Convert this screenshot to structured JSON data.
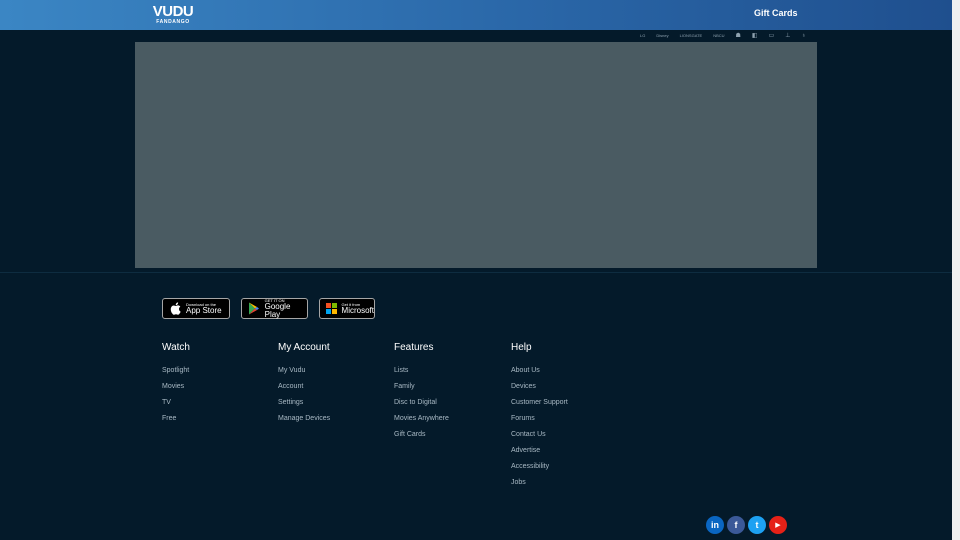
{
  "header": {
    "logo_main": "VUDU",
    "logo_sub": "FANDANGO",
    "gift_cards": "Gift Cards"
  },
  "studios": [
    "Lionsgate-icon",
    "Disney",
    "paramount-icon",
    "CANNON",
    "UNIVERSAL",
    "warner-icon",
    "dreamworks-icon",
    "studio-icon",
    "fox-icon",
    "mgm-icon"
  ],
  "studio_text": [
    "LG",
    "Disney",
    "LIONSGATE",
    "NBCU",
    "☗",
    "◧",
    "▭",
    "⊥",
    "♁"
  ],
  "badges": {
    "apple": {
      "small": "Download on the",
      "big": "App Store"
    },
    "google": {
      "small": "GET IT ON",
      "big": "Google Play"
    },
    "microsoft": {
      "small": "Get it from",
      "big": "Microsoft"
    }
  },
  "footer": {
    "watch": {
      "title": "Watch",
      "items": [
        "Spotlight",
        "Movies",
        "TV",
        "Free"
      ]
    },
    "account": {
      "title": "My Account",
      "items": [
        "My Vudu",
        "Account",
        "Settings",
        "Manage Devices"
      ]
    },
    "features": {
      "title": "Features",
      "items": [
        "Lists",
        "Family",
        "Disc to Digital",
        "Movies Anywhere",
        "Gift Cards"
      ]
    },
    "help": {
      "title": "Help",
      "items": [
        "About Us",
        "Devices",
        "Customer Support",
        "Forums",
        "Contact Us",
        "Advertise",
        "Accessibility",
        "Jobs"
      ]
    }
  },
  "social": {
    "linkedin": "in",
    "facebook": "f",
    "twitter": "t",
    "youtube": "▶"
  },
  "colors": {
    "header_start": "#3b86c4",
    "header_end": "#1f4f8e",
    "background": "#041a2a",
    "hero": "#4a5b62",
    "linkedin": "#0a66c2",
    "facebook": "#3b5998",
    "twitter": "#1da1f2",
    "youtube": "#e62117"
  }
}
